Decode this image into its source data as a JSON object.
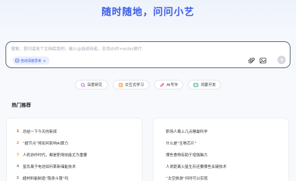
{
  "hero": {
    "title": "随时随地，问问小艺"
  },
  "composer": {
    "placeholder": "搜索、提问或发个文档给我吧，输入@选择技能，支持shift+enter换行",
    "deep_think_label": "自动深度思考",
    "icons": [
      "deep-think-icon",
      "chevron-down-icon",
      "paperclip-icon",
      "image-icon",
      "send-arrow-icon"
    ]
  },
  "quick_actions": [
    {
      "label": "深度研究",
      "icon": "research-icon",
      "color": "#b463e8"
    },
    {
      "label": "交互式学习",
      "icon": "book-icon",
      "color": "#f08a24"
    },
    {
      "label": "AI写作",
      "icon": "pen-icon",
      "color": "#e0438f"
    },
    {
      "label": "鸿蒙开发",
      "icon": "code-icon",
      "color": "#27a37a"
    }
  ],
  "trending": {
    "title": "热门推荐",
    "left": [
      {
        "rank": "1",
        "text": "总结一下今天的新闻"
      },
      {
        "rank": "2",
        "text": "“超节点”将如何影响AI算力"
      },
      {
        "rank": "3",
        "text": "人机协作时代，都是职场技能尤为重要"
      },
      {
        "rank": "4",
        "text": "氢负离子电池如何革新储能技术"
      },
      {
        "rank": "5",
        "text": "超材料能制造“隐身斗篷”吗"
      }
    ],
    "right": [
      {
        "text": "职场人晚上几点睡最科学"
      },
      {
        "text": "什么是“生物芯片”"
      },
      {
        "text": "哪些食物有助于增强脑力"
      },
      {
        "text": "人类距离火星生存还要哪些关键技术"
      },
      {
        "text": "“太空旅游”何时可以实现"
      }
    ]
  },
  "colors": {
    "accent": "#3a5ce8",
    "rank1": "#e34a3b",
    "rank2": "#f08a24",
    "rank3": "#f4b33d"
  }
}
